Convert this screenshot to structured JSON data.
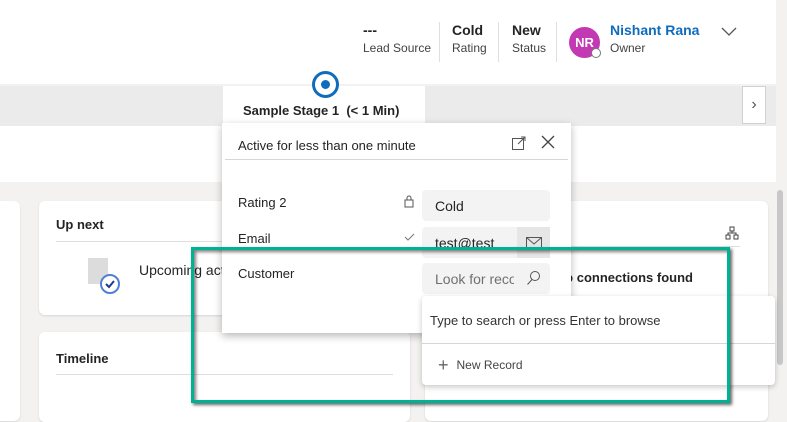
{
  "header": {
    "fields": [
      {
        "value": "---",
        "label": "Lead Source"
      },
      {
        "value": "Cold",
        "label": "Rating"
      },
      {
        "value": "New",
        "label": "Status"
      }
    ],
    "owner": {
      "initials": "NR",
      "name": "Nishant Rana",
      "label": "Owner"
    }
  },
  "stage": {
    "name": "Sample Stage 1",
    "duration": "(< 1 Min)"
  },
  "flyout": {
    "title": "Active for less than one minute",
    "fields": [
      {
        "label": "Rating 2",
        "value": "Cold"
      },
      {
        "label": "Email",
        "value": "test@test"
      },
      {
        "label": "Customer",
        "placeholder": "Look for records"
      }
    ],
    "dropdown": {
      "hint": "Type to search or press Enter to browse",
      "new_record": "New Record"
    }
  },
  "cards": {
    "up_next": {
      "title": "Up next",
      "text": "Upcoming activities"
    },
    "timeline": {
      "title": "Timeline"
    },
    "connections": {
      "text": "No connections found"
    }
  },
  "colors": {
    "accent": "#0f6cbd",
    "highlight": "#00b294",
    "avatar": "#c239b3"
  }
}
